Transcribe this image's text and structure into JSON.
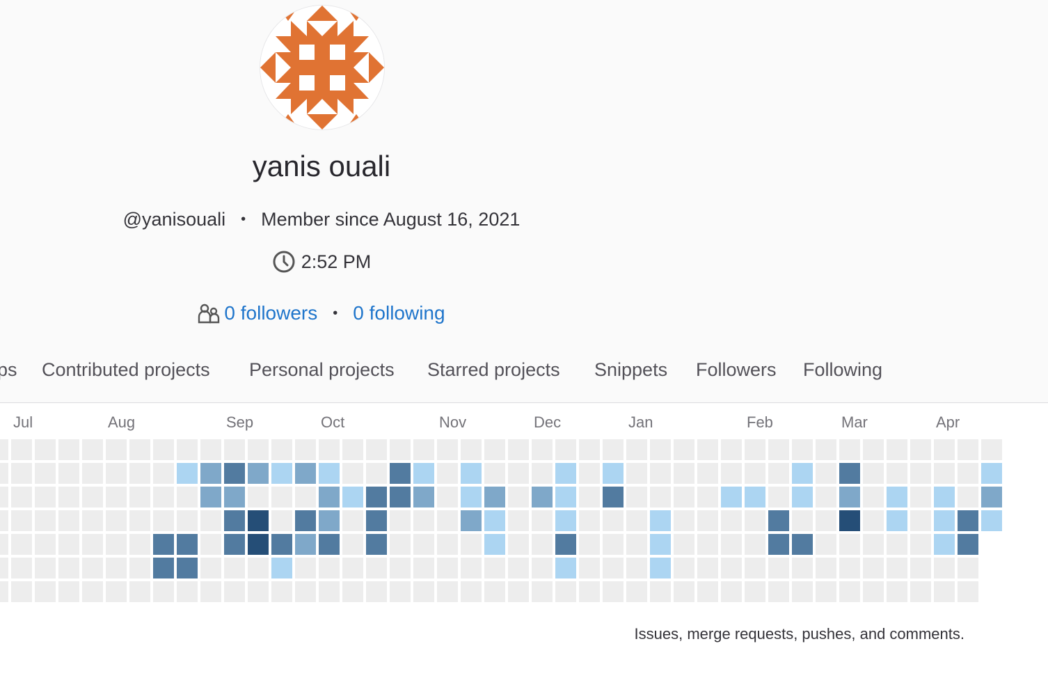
{
  "profile": {
    "name": "yanis ouali",
    "username": "@yanisouali",
    "member_since": "Member since August 16, 2021",
    "local_time": "2:52 PM",
    "followers": "0 followers",
    "following": "0 following",
    "colors": {
      "avatar": "#e07333",
      "link": "#1f75cb"
    }
  },
  "tabs": [
    {
      "label": "ps"
    },
    {
      "label": "Contributed projects"
    },
    {
      "label": "Personal projects"
    },
    {
      "label": "Starred projects"
    },
    {
      "label": "Snippets"
    },
    {
      "label": "Followers"
    },
    {
      "label": "Following"
    }
  ],
  "calendar": {
    "months": [
      "Jul",
      "Aug",
      "Sep",
      "Oct",
      "Nov",
      "Dec",
      "Jan",
      "Feb",
      "Mar",
      "Apr"
    ],
    "levels_by_week": [
      "0000000",
      "0000000",
      "0000000",
      "0000000",
      "0000000",
      "0000000",
      "0000000",
      "0000330",
      "0100330",
      "0220000",
      "0323300",
      "0204400",
      "0100310",
      "0203200",
      "0122300",
      "0010000",
      "0033300",
      "0330000",
      "0120000",
      "0000000",
      "0112000",
      "0021100",
      "0000000",
      "0020000",
      "0111310",
      "0000000",
      "0130000",
      "0000000",
      "0001110",
      "0000000",
      "0000000",
      "0010000",
      "0010000",
      "0003300",
      "0110300",
      "0000000",
      "0324000",
      "0000000",
      "0011000",
      "0000000",
      "0011100",
      "0003300",
      "0121100"
    ],
    "colors": [
      "#ededed",
      "#acd5f2",
      "#7fa8c9",
      "#527ba0",
      "#254e77"
    ],
    "legend": "Issues, merge requests, pushes, and comments."
  }
}
